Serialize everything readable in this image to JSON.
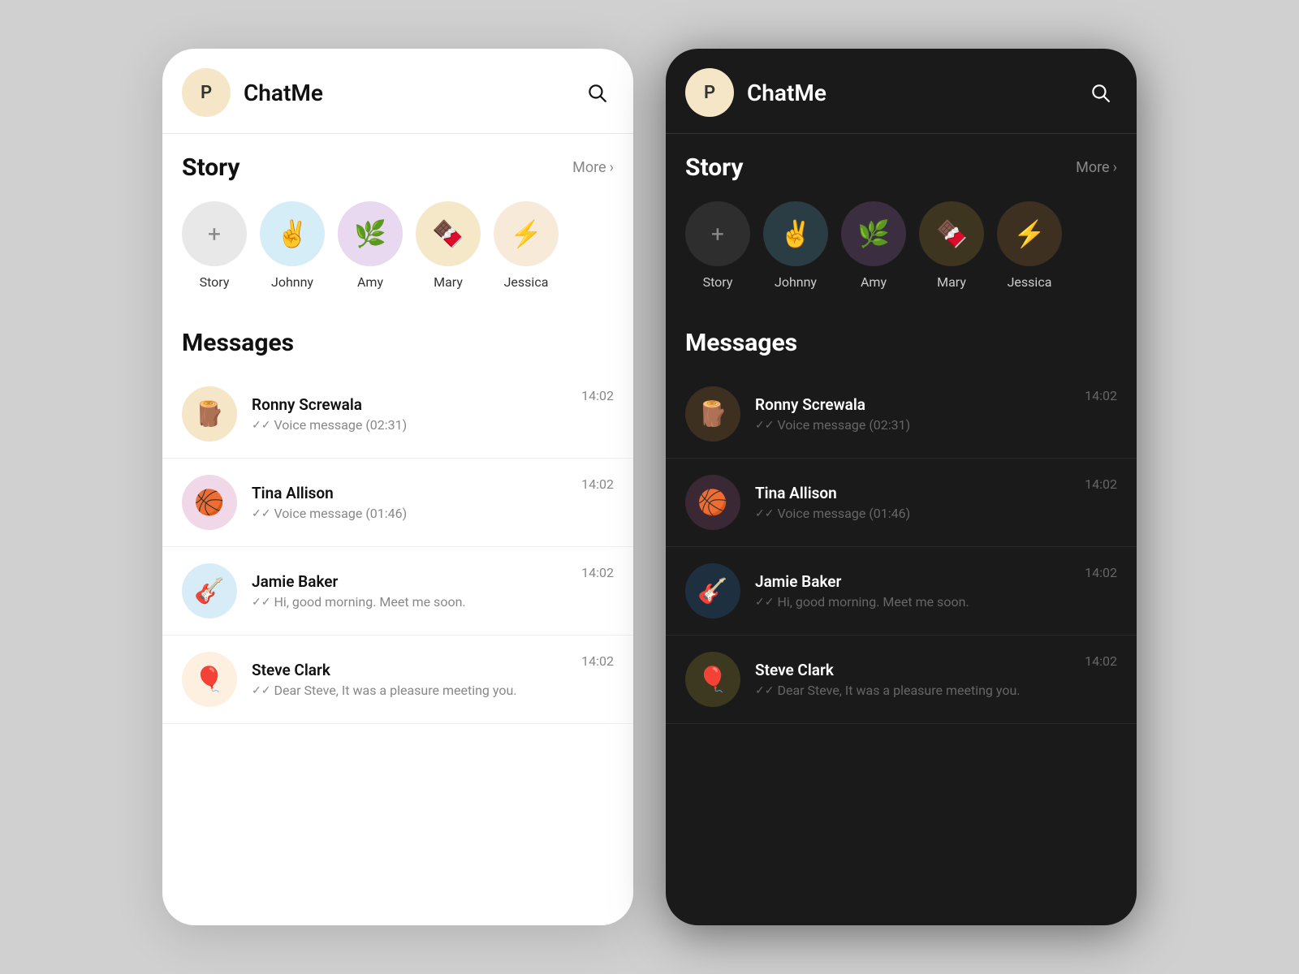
{
  "app": {
    "title": "ChatMe",
    "user_initial": "P"
  },
  "story": {
    "section_label": "Story",
    "more_label": "More",
    "items": [
      {
        "id": "add",
        "label": "Story",
        "emoji": "+",
        "bg_class": "story-add"
      },
      {
        "id": "johnny",
        "label": "Johnny",
        "emoji": "✌️",
        "bg_class": "story-johnny"
      },
      {
        "id": "amy",
        "label": "Amy",
        "emoji": "🌿",
        "bg_class": "story-amy"
      },
      {
        "id": "mary",
        "label": "Mary",
        "emoji": "🍫",
        "bg_class": "story-mary"
      },
      {
        "id": "jessica",
        "label": "Jessica",
        "emoji": "⚡",
        "bg_class": "story-jessica"
      }
    ]
  },
  "messages": {
    "section_label": "Messages",
    "items": [
      {
        "id": "ronny",
        "name": "Ronny Screwala",
        "preview": "Voice message (02:31)",
        "time": "14:02",
        "emoji": "🪵",
        "bg_class": "msg-ronny"
      },
      {
        "id": "tina",
        "name": "Tina Allison",
        "preview": "Voice message (01:46)",
        "time": "14:02",
        "emoji": "🏀",
        "bg_class": "msg-tina"
      },
      {
        "id": "jamie",
        "name": "Jamie Baker",
        "preview": "Hi, good morning. Meet me soon.",
        "time": "14:02",
        "emoji": "🎸",
        "bg_class": "msg-jamie"
      },
      {
        "id": "steve",
        "name": "Steve Clark",
        "preview": "Dear Steve, It was a pleasure meeting you.",
        "time": "14:02",
        "emoji": "🎈",
        "bg_class": "msg-steve"
      }
    ]
  }
}
